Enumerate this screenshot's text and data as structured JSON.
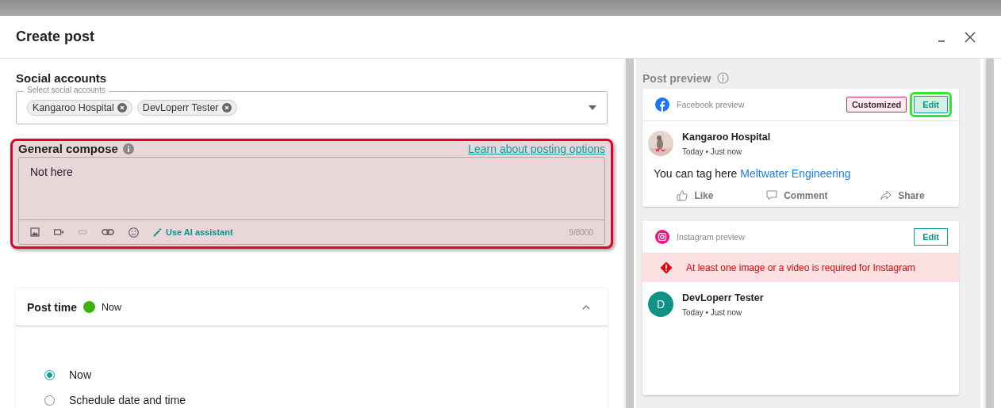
{
  "dialog": {
    "title": "Create post"
  },
  "social_accounts": {
    "title": "Social accounts",
    "field_label": "Select social accounts",
    "chips": [
      "Kangaroo Hospital",
      "DevLoperr Tester"
    ]
  },
  "general_compose": {
    "title": "General compose",
    "link": "Learn about posting options",
    "value": "Not here",
    "ai_button": "Use AI assistant",
    "counter": "9/8000",
    "highlighted": true
  },
  "post_time": {
    "title": "Post time",
    "status": "Now",
    "expanded": true,
    "options": [
      {
        "label": "Now",
        "selected": true
      },
      {
        "label": "Schedule date and time",
        "selected": false
      }
    ]
  },
  "post_preview": {
    "title": "Post preview",
    "cards": [
      {
        "kind": "facebook",
        "label": "Facebook preview",
        "badge": "Customized",
        "edit": "Edit",
        "edit_highlighted": true,
        "author": "Kangaroo Hospital",
        "time": "Today • Just now",
        "text": "You can tag here",
        "tag": "Meltwater Engineering",
        "actions": [
          "Like",
          "Comment",
          "Share"
        ]
      },
      {
        "kind": "instagram",
        "label": "Instagram preview",
        "edit": "Edit",
        "edit_highlighted": false,
        "warning": "At least one image or a video is required for Instagram",
        "avatar_letter": "D",
        "author": "DevLoperr Tester",
        "time": "Today • Just now"
      }
    ]
  }
}
